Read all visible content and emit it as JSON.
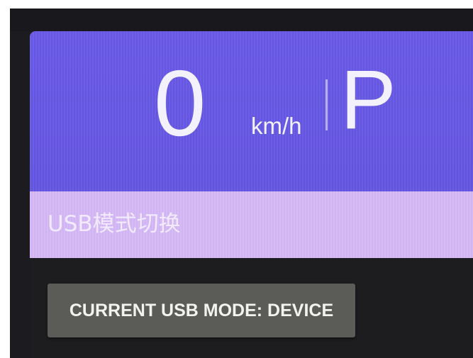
{
  "dashboard": {
    "speed": "0",
    "speed_unit": "km/h",
    "gear": "P"
  },
  "title_bar": {
    "title": "USB模式切换"
  },
  "usb_mode": {
    "button_label": "CURRENT USB MODE: DEVICE"
  },
  "colors": {
    "speed_panel": "#6a5ae8",
    "title_bar": "#d4b8f7",
    "background": "#1c1b20",
    "button": "#5b5c58"
  }
}
